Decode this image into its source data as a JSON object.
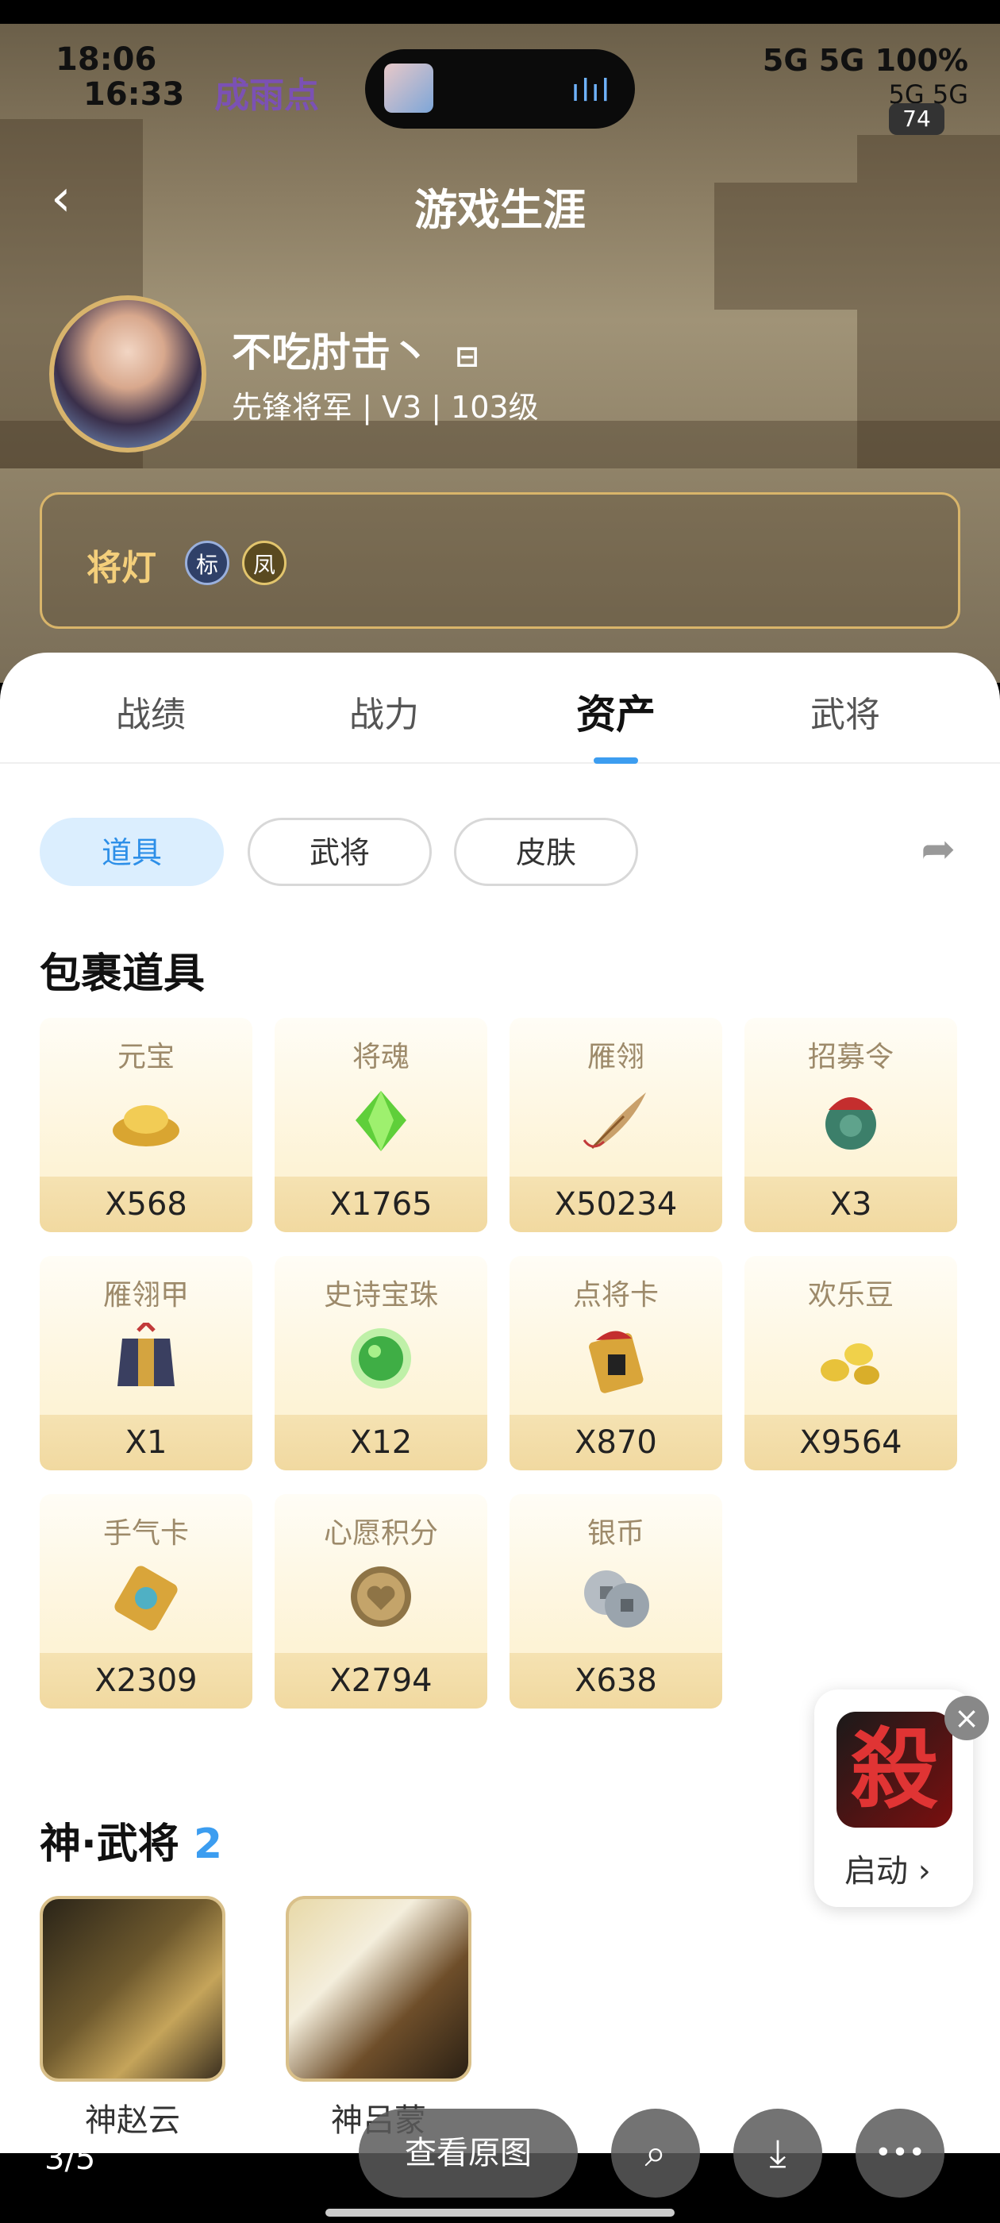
{
  "status_bar": {
    "time_main": "18:06",
    "time_secondary": "16:33",
    "channel_text": "成雨点",
    "signal_text": "5G 5G 100%",
    "signal_text_2": "5G 5G",
    "battery": "74"
  },
  "header": {
    "back_icon": "‹",
    "title": "游戏生涯"
  },
  "profile": {
    "name": "不吃肘击丶",
    "name_icon": "⊟",
    "subtitle": "先锋将军 | V3 | 103级"
  },
  "lamp": {
    "label": "将灯",
    "badges": [
      "标",
      "凤"
    ]
  },
  "tabs": [
    {
      "label": "战绩"
    },
    {
      "label": "战力"
    },
    {
      "label": "资产"
    },
    {
      "label": "武将"
    }
  ],
  "chips": [
    {
      "label": "道具"
    },
    {
      "label": "武将"
    },
    {
      "label": "皮肤"
    }
  ],
  "share_icon": "➦",
  "bag": {
    "title": "包裹道具",
    "items": [
      {
        "name": "元宝",
        "qty": "X568",
        "icon": "gold-ingot-icon",
        "color": "#e3b43b"
      },
      {
        "name": "将魂",
        "qty": "X1765",
        "icon": "green-crystal-icon",
        "color": "#62c43a"
      },
      {
        "name": "雁翎",
        "qty": "X50234",
        "icon": "feather-icon",
        "color": "#c9a06a"
      },
      {
        "name": "招募令",
        "qty": "X3",
        "icon": "recruit-token-icon",
        "color": "#3c7f6a"
      },
      {
        "name": "雁翎甲",
        "qty": "X1",
        "icon": "armor-icon",
        "color": "#3a3f60"
      },
      {
        "name": "史诗宝珠",
        "qty": "X12",
        "icon": "green-orb-icon",
        "color": "#3fae45"
      },
      {
        "name": "点将卡",
        "qty": "X870",
        "icon": "general-card-icon",
        "color": "#d9a53a"
      },
      {
        "name": "欢乐豆",
        "qty": "X9564",
        "icon": "beans-icon",
        "color": "#e8c23a"
      },
      {
        "name": "手气卡",
        "qty": "X2309",
        "icon": "luck-card-icon",
        "color": "#4fb0c4"
      },
      {
        "name": "心愿积分",
        "qty": "X2794",
        "icon": "heart-coin-icon",
        "color": "#b8955a"
      },
      {
        "name": "银币",
        "qty": "X638",
        "icon": "silver-coin-icon",
        "color": "#9aa4ad"
      }
    ]
  },
  "generals": {
    "title": "神·武将",
    "count": "2",
    "list": [
      {
        "name": "神赵云"
      },
      {
        "name": "神吕蒙"
      }
    ]
  },
  "float_app": {
    "logo_char": "殺",
    "launch_label": "启动 ›",
    "close_icon": "×"
  },
  "viewer": {
    "pager": "3/5",
    "view_original": "查看原图",
    "search_icon": "⌕",
    "download_icon": "⤓",
    "more_icon": "•••"
  }
}
